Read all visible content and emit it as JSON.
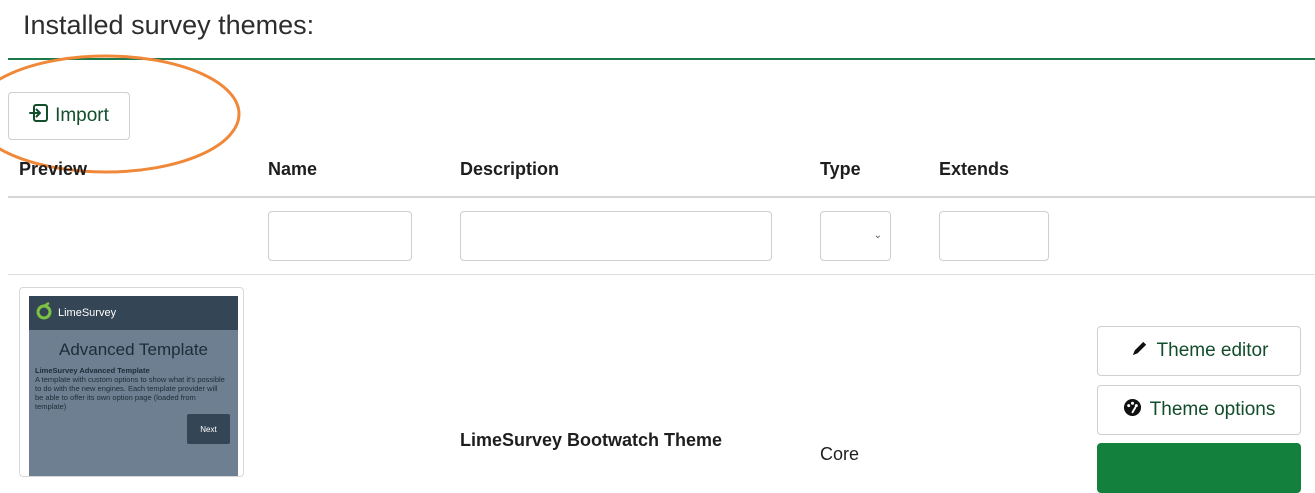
{
  "page": {
    "title": "Installed survey themes:"
  },
  "toolbar": {
    "import_label": "Import"
  },
  "table": {
    "headers": [
      "Preview",
      "Name",
      "Description",
      "Type",
      "Extends"
    ],
    "filters": {
      "name_value": "",
      "description_value": "",
      "type_selected": "",
      "extends_value": ""
    },
    "rows": [
      {
        "preview": {
          "brand": "LimeSurvey",
          "headline": "Advanced Template",
          "subhead": "LimeSurvey Advanced Template",
          "body": "A template with custom options to show what it's possible to do with the new engines. Each template provider will be able to offer its own option page (loaded from template)",
          "next_label": "Next"
        },
        "name": "LimeSurvey Bootwatch Theme",
        "type": "Core",
        "actions": {
          "theme_editor": "Theme editor",
          "theme_options": "Theme options",
          "third": ""
        }
      }
    ]
  },
  "colors": {
    "accent": "#1a7a4a",
    "primary_button": "#14803e",
    "annotation": "#f0883a"
  },
  "icons": [
    "import-icon",
    "pencil-icon",
    "palette-icon",
    "limesurvey-logo"
  ]
}
